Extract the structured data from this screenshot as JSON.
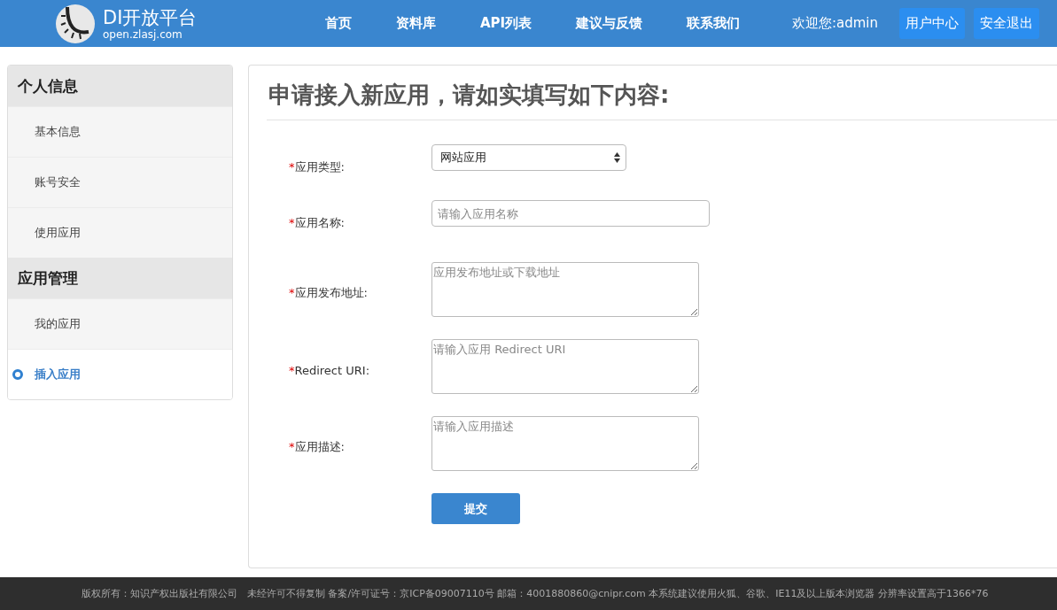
{
  "header": {
    "logo_title": "DI开放平台",
    "logo_subtitle": "open.zlasj.com",
    "nav": [
      {
        "label": "首页"
      },
      {
        "label": "资料库"
      },
      {
        "label": "API列表"
      },
      {
        "label": "建议与反馈"
      },
      {
        "label": "联系我们"
      }
    ],
    "welcome": "欢迎您:admin",
    "buttons": [
      {
        "label": "用户中心"
      },
      {
        "label": "安全退出"
      }
    ]
  },
  "sidebar": {
    "groups": [
      {
        "title": "个人信息",
        "items": [
          {
            "label": "基本信息",
            "selected": false
          },
          {
            "label": "账号安全",
            "selected": false
          },
          {
            "label": "使用应用",
            "selected": false
          }
        ]
      },
      {
        "title": "应用管理",
        "items": [
          {
            "label": "我的应用",
            "selected": false
          },
          {
            "label": "插入应用",
            "selected": true
          }
        ]
      }
    ]
  },
  "form": {
    "title": "申请接入新应用，请如实填写如下内容:",
    "fields": [
      {
        "kind": "select",
        "required_mark": "*",
        "label": "应用类型:",
        "value": "网站应用"
      },
      {
        "kind": "input",
        "required_mark": "*",
        "label": "应用名称:",
        "placeholder": "请输入应用名称"
      },
      {
        "kind": "textarea",
        "required_mark": "*",
        "label": "应用发布地址:",
        "placeholder": "应用发布地址或下载地址"
      },
      {
        "kind": "textarea",
        "required_mark": "*",
        "label": "Redirect URI:",
        "placeholder": "请输入应用 Redirect URI"
      },
      {
        "kind": "textarea",
        "required_mark": "*",
        "label": "应用描述:",
        "placeholder": "请输入应用描述"
      }
    ],
    "submit": "提交"
  },
  "footer": "版权所有：知识产权出版社有限公司　未经许可不得复制 备案/许可证号：京ICP备09007110号 邮箱：4001880860@cnipr.com 本系统建议使用火狐、谷歌、IE11及以上版本浏览器 分辨率设置高于1366*76"
}
